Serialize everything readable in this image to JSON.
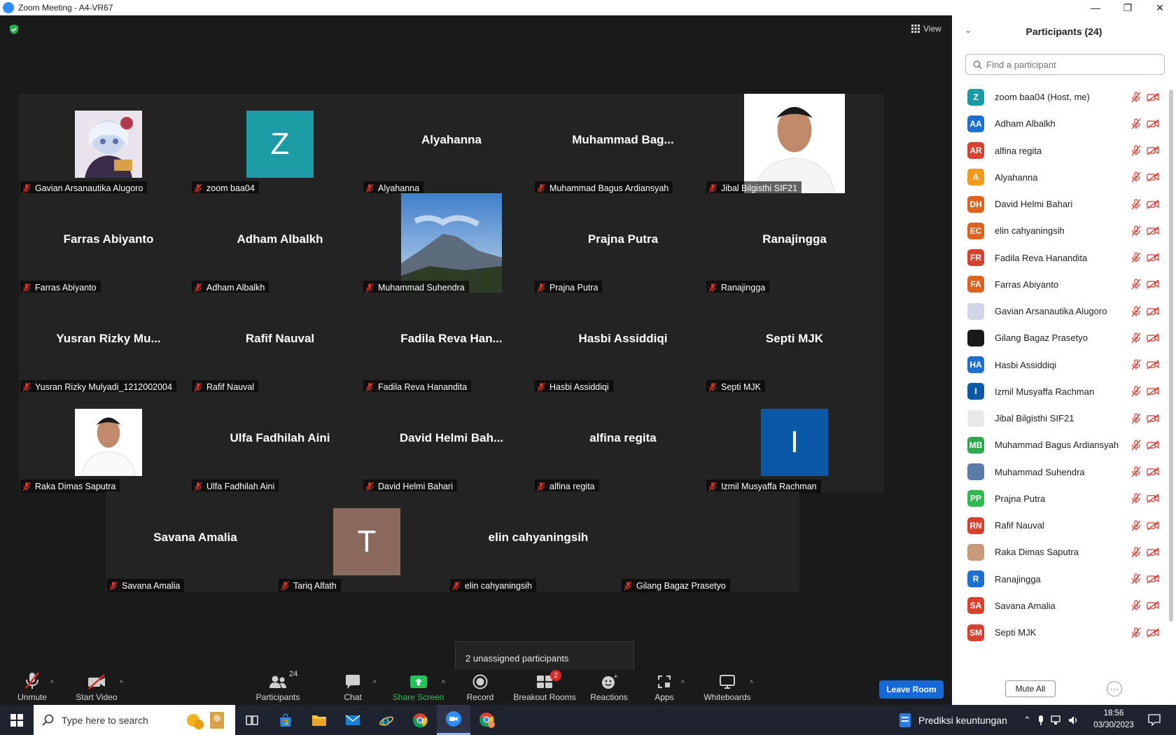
{
  "window": {
    "title": "Zoom Meeting - A4-VR67",
    "minimize": "—",
    "maximize": "❐",
    "close": "✕"
  },
  "meeting": {
    "view_label": "View",
    "unassigned_popup": "2 unassigned participants"
  },
  "tiles": [
    {
      "display": "avatar-image",
      "big": "",
      "label": "Gavian Arsanautika Alugoro"
    },
    {
      "display": "letter",
      "big": "Z",
      "color": "#1a9ba6",
      "label": "zoom baa04"
    },
    {
      "display": "name",
      "big": "Alyahanna",
      "label": "Alyahanna"
    },
    {
      "display": "name",
      "big": "Muhammad  Bag...",
      "label": "Muhammad Bagus Ardiansyah"
    },
    {
      "display": "photo-person",
      "big": "",
      "label": "Jibal Bilgisthi SIF21"
    },
    {
      "display": "name",
      "big": "Farras Abiyanto",
      "label": "Farras Abiyanto"
    },
    {
      "display": "name",
      "big": "Adham Albalkh",
      "label": "Adham Albalkh"
    },
    {
      "display": "photo-mountain",
      "big": "",
      "label": "Muhammad Suhendra"
    },
    {
      "display": "name",
      "big": "Prajna Putra",
      "label": "Prajna Putra"
    },
    {
      "display": "name",
      "big": "Ranajingga",
      "label": "Ranajingga"
    },
    {
      "display": "name",
      "big": "Yusran  Rizky  Mu...",
      "label": "Yusran Rizky Mulyadi_1212002004"
    },
    {
      "display": "name",
      "big": "Rafif Nauval",
      "label": "Rafif Nauval"
    },
    {
      "display": "name",
      "big": "Fadila  Reva  Han...",
      "label": "Fadila Reva Hanandita"
    },
    {
      "display": "name",
      "big": "Hasbi Assiddiqi",
      "label": "Hasbi Assiddiqi"
    },
    {
      "display": "name",
      "big": "Septi MJK",
      "label": "Septi MJK"
    },
    {
      "display": "photo-person2",
      "big": "",
      "label": "Raka Dimas Saputra"
    },
    {
      "display": "name",
      "big": "Ulfa Fadhilah Aini",
      "label": "Ulfa Fadhilah Aini"
    },
    {
      "display": "name",
      "big": "David  Helmi  Bah...",
      "label": "David Helmi Bahari"
    },
    {
      "display": "name",
      "big": "alfina regita",
      "label": "alfina regita"
    },
    {
      "display": "letter",
      "big": "I",
      "color": "#0a5aa8",
      "label": "Izmil Musyaffa Rachman"
    },
    {
      "display": "name",
      "big": "Savana Amalia",
      "label": "Savana Amalia"
    },
    {
      "display": "letter",
      "big": "T",
      "color": "#8a6a5c",
      "label": "Tariq Alfath"
    },
    {
      "display": "name",
      "big": "elin cahyaningsih",
      "label": "elin cahyaningsih"
    },
    {
      "display": "blank",
      "big": "",
      "label": "Gilang Bagaz Prasetyo"
    }
  ],
  "toolbar": {
    "unmute": "Unmute",
    "start_video": "Start Video",
    "participants": "Participants",
    "participants_count": "24",
    "chat": "Chat",
    "share_screen": "Share Screen",
    "record": "Record",
    "breakout_rooms": "Breakout Rooms",
    "breakout_badge": "2",
    "reactions": "Reactions",
    "apps": "Apps",
    "whiteboards": "Whiteboards",
    "leave_room": "Leave Room"
  },
  "panel": {
    "title": "Participants (24)",
    "search_placeholder": "Find a participant",
    "mute_all": "Mute All",
    "more": "···",
    "participants": [
      {
        "initials": "Z",
        "color": "#1a9ba6",
        "name": "zoom baa04 (Host, me)"
      },
      {
        "initials": "AA",
        "color": "#1d6fd1",
        "name": "Adham Albalkh"
      },
      {
        "initials": "AR",
        "color": "#d9412f",
        "name": "alfina regita"
      },
      {
        "initials": "A",
        "color": "#f29a1d",
        "name": "Alyahanna"
      },
      {
        "initials": "DH",
        "color": "#e0621e",
        "name": "David Helmi Bahari"
      },
      {
        "initials": "EC",
        "color": "#e0621e",
        "name": "elin cahyaningsih"
      },
      {
        "initials": "FR",
        "color": "#d9412f",
        "name": "Fadila Reva Hanandita"
      },
      {
        "initials": "FA",
        "color": "#e0621e",
        "name": "Farras Abiyanto"
      },
      {
        "initials": "",
        "color": "#cfd4e6",
        "name": "Gavian Arsanautika Alugoro"
      },
      {
        "initials": "",
        "color": "#1a1a1a",
        "name": "Gilang Bagaz Prasetyo"
      },
      {
        "initials": "HA",
        "color": "#1d6fd1",
        "name": "Hasbi Assiddiqi"
      },
      {
        "initials": "I",
        "color": "#0a5aa8",
        "name": "Izmil Musyaffa Rachman"
      },
      {
        "initials": "",
        "color": "#e8e8e8",
        "name": "Jibal Bilgisthi SIF21"
      },
      {
        "initials": "MB",
        "color": "#2fa84f",
        "name": "Muhammad Bagus Ardiansyah"
      },
      {
        "initials": "",
        "color": "#5b7aa8",
        "name": "Muhammad Suhendra"
      },
      {
        "initials": "PP",
        "color": "#2fbb4f",
        "name": "Prajna Putra"
      },
      {
        "initials": "RN",
        "color": "#d9412f",
        "name": "Rafif Nauval"
      },
      {
        "initials": "",
        "color": "#c89a7a",
        "name": "Raka Dimas Saputra"
      },
      {
        "initials": "R",
        "color": "#1d6fd1",
        "name": "Ranajingga"
      },
      {
        "initials": "SA",
        "color": "#d9412f",
        "name": "Savana Amalia"
      },
      {
        "initials": "SM",
        "color": "#d9412f",
        "name": "Septi MJK"
      }
    ]
  },
  "taskbar": {
    "search_text": "Type here to search",
    "notification_text": "Prediksi keuntungan",
    "time": "18:56",
    "date": "03/30/2023"
  }
}
